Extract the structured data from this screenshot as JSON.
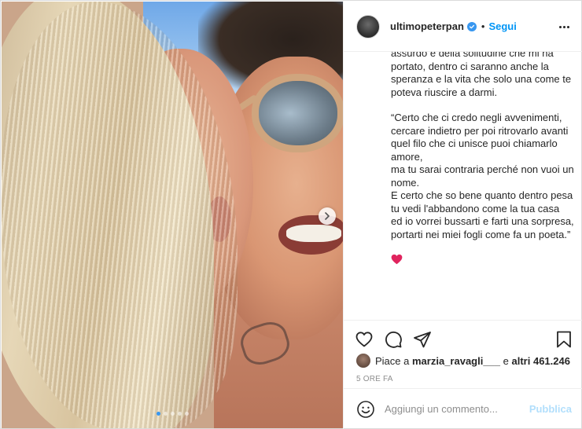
{
  "header": {
    "username": "ultimopeterpan",
    "separator": "•",
    "follow_label": "Segui",
    "icons": {
      "avatar": "profile-avatar",
      "verified": "verified-badge-icon",
      "more": "more-options-icon"
    }
  },
  "media": {
    "icons": {
      "next": "chevron-right-icon"
    },
    "carousel_count": 5,
    "active_index": 0
  },
  "caption": {
    "paragraphs": [
      "assurdo e della solitudine che mi ha portato, dentro ci saranno anche la speranza e la vita che solo una come te poteva riuscire a darmi.",
      "“Certo che ci credo negli avvenimenti,\ncercare indietro per poi ritrovarlo avanti\nquel filo che ci unisce puoi chiamarlo amore,\nma tu sarai contraria perché non vuoi un nome.\nE certo che so bene quanto dentro pesa\ntu vedi l'abbandono come la tua casa\ned io vorrei bussarti e farti una sorpresa,\nportarti nei miei fogli come fa un poeta.”"
    ],
    "emoji": "red-heart-emoji"
  },
  "actions": {
    "icons": {
      "like": "heart-outline-icon",
      "comment": "comment-bubble-icon",
      "share": "paper-plane-icon",
      "save": "bookmark-icon"
    },
    "likes_prefix": "Piace a",
    "likes_user": "marzia_ravagli___",
    "likes_middle": "e",
    "likes_others": "altri 461.246",
    "timestamp": "5 ORE FA"
  },
  "comment": {
    "placeholder": "Aggiungi un commento...",
    "publish_label": "Pubblica",
    "icons": {
      "emoji": "smiley-icon"
    }
  },
  "colors": {
    "accent": "#0095f6",
    "publish_disabled": "#b2dffc",
    "muted": "#8e8e8e",
    "border": "#efefef"
  }
}
